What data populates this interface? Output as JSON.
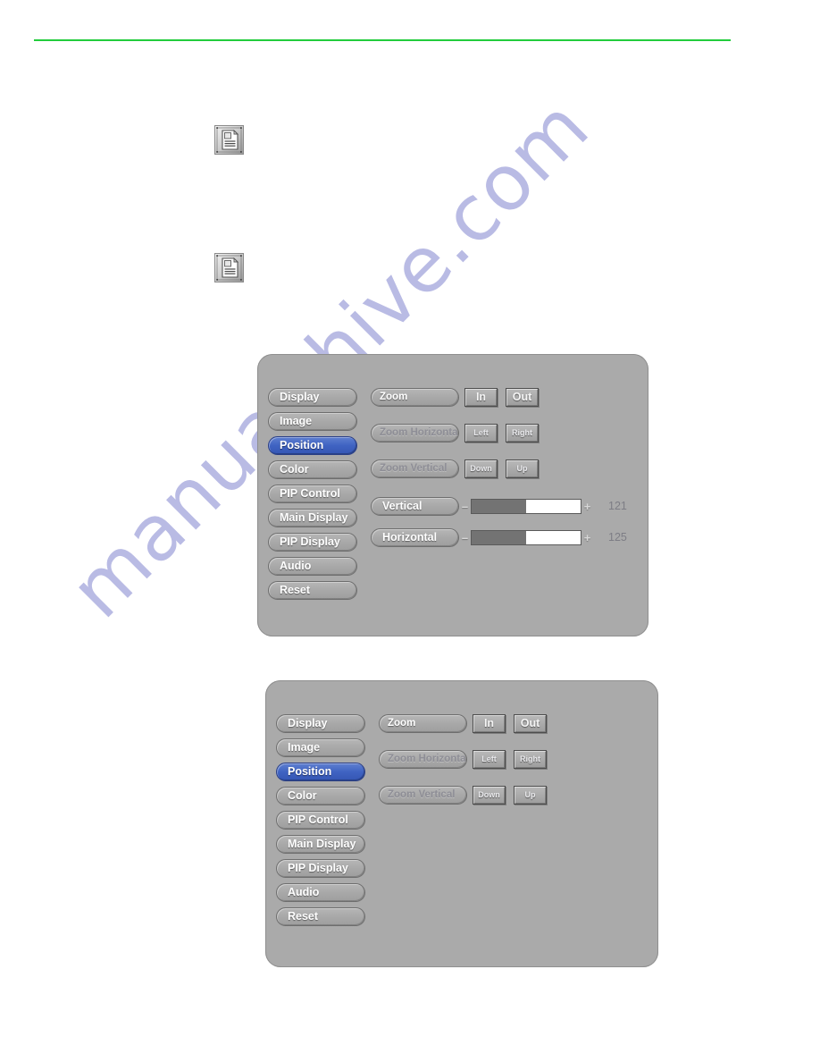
{
  "page": {
    "rule_color": "#22cc3c",
    "watermark_text": "manualshive.com",
    "watermark_color": "#b9bbe4"
  },
  "notes": [
    {
      "icon": "note-document-icon"
    },
    {
      "icon": "note-document-icon"
    }
  ],
  "osd": {
    "panel_bg": "#aaaaaa",
    "selected_color": "#3f63c2",
    "menu_items": [
      {
        "label": "Display",
        "selected": false
      },
      {
        "label": "Image",
        "selected": false
      },
      {
        "label": "Position",
        "selected": true
      },
      {
        "label": "Color",
        "selected": false
      },
      {
        "label": "PIP Control",
        "selected": false
      },
      {
        "label": "Main Display",
        "selected": false
      },
      {
        "label": "PIP Display",
        "selected": false
      },
      {
        "label": "Audio",
        "selected": false
      },
      {
        "label": "Reset",
        "selected": false
      }
    ],
    "functions": [
      {
        "label": "Zoom",
        "dim": false
      },
      {
        "label": "Zoom Horizontal",
        "dim": true
      },
      {
        "label": "Zoom Vertical",
        "dim": true
      }
    ],
    "button_rows": [
      {
        "left": "In",
        "right": "Out",
        "size": "big"
      },
      {
        "left": "Left",
        "right": "Right",
        "size": "small"
      },
      {
        "left": "Down",
        "right": "Up",
        "size": "small"
      }
    ],
    "sliders": [
      {
        "label": "Vertical",
        "minus": "–",
        "plus": "+",
        "value": "121",
        "fill_percent": 50
      },
      {
        "label": "Horizontal",
        "minus": "–",
        "plus": "+",
        "value": "125",
        "fill_percent": 50
      }
    ]
  }
}
